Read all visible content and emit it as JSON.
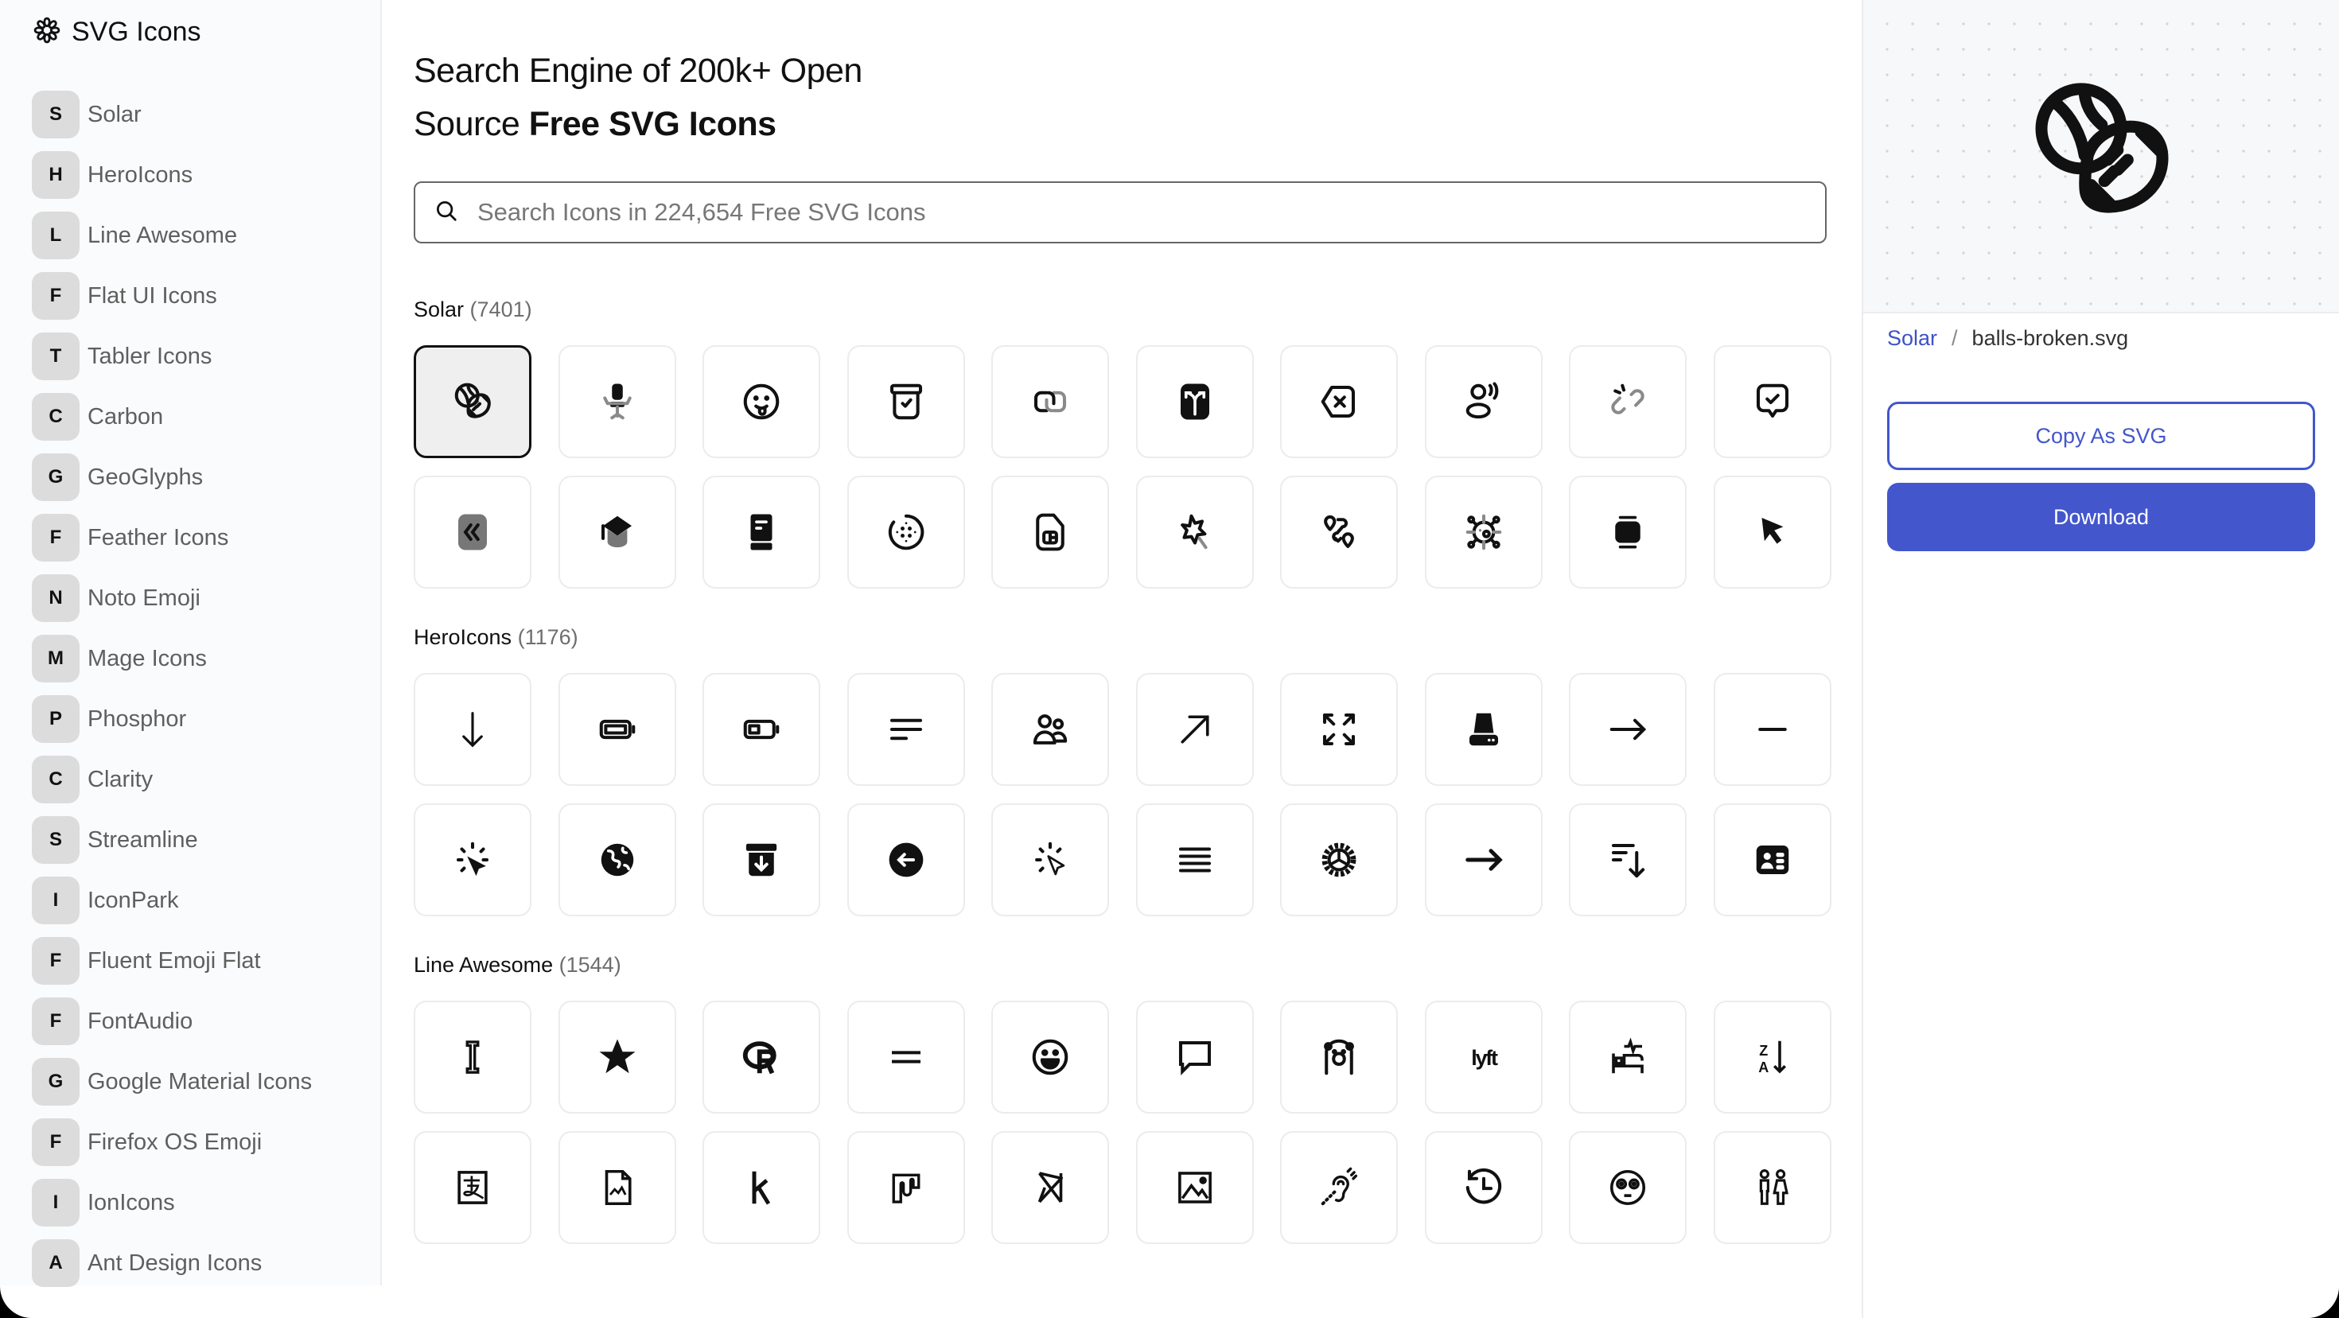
{
  "app": {
    "title": "SVG Icons",
    "logo_icon": "flower-outline-icon"
  },
  "sidebar": {
    "items": [
      {
        "letter": "S",
        "label": "Solar"
      },
      {
        "letter": "H",
        "label": "HeroIcons"
      },
      {
        "letter": "L",
        "label": "Line Awesome"
      },
      {
        "letter": "F",
        "label": "Flat UI Icons"
      },
      {
        "letter": "T",
        "label": "Tabler Icons"
      },
      {
        "letter": "C",
        "label": "Carbon"
      },
      {
        "letter": "G",
        "label": "GeoGlyphs"
      },
      {
        "letter": "F",
        "label": "Feather Icons"
      },
      {
        "letter": "N",
        "label": "Noto Emoji"
      },
      {
        "letter": "M",
        "label": "Mage Icons"
      },
      {
        "letter": "P",
        "label": "Phosphor"
      },
      {
        "letter": "C",
        "label": "Clarity"
      },
      {
        "letter": "S",
        "label": "Streamline"
      },
      {
        "letter": "I",
        "label": "IconPark"
      },
      {
        "letter": "F",
        "label": "Fluent Emoji Flat"
      },
      {
        "letter": "F",
        "label": "FontAudio"
      },
      {
        "letter": "G",
        "label": "Google Material Icons"
      },
      {
        "letter": "F",
        "label": "Firefox OS Emoji"
      },
      {
        "letter": "I",
        "label": "IonIcons"
      },
      {
        "letter": "A",
        "label": "Ant Design Icons"
      }
    ]
  },
  "hero": {
    "line1": "Search Engine of 200k+ Open",
    "line2_prefix": "Source ",
    "line2_bold": "Free SVG Icons"
  },
  "search": {
    "placeholder": "Search Icons in 224,654 Free SVG Icons",
    "value": "",
    "icon": "search-icon"
  },
  "sections": [
    {
      "name": "Solar",
      "count": "(7401)",
      "icons": [
        "balls-broken",
        "office-chair",
        "emoji-tongue",
        "archive-check",
        "link-square",
        "routing-split",
        "backspace-x",
        "user-speak",
        "link-broken",
        "chat-check",
        "double-alt-arrow-left",
        "graduation-cap",
        "book-bookmark",
        "speaker-dots",
        "sim-card",
        "magic-star-stick",
        "route-pins",
        "virus",
        "gallery-wide",
        "cursor"
      ]
    },
    {
      "name": "HeroIcons",
      "count": "(1176)",
      "icons": [
        "arrow-down",
        "battery-full",
        "battery-half",
        "bars-3-bottom-left",
        "users",
        "arrow-up-right",
        "arrows-pointing-out",
        "server-stack",
        "arrow-right",
        "minus",
        "cursor-rays-solid",
        "globe-europe-africa",
        "archive-box-arrow-down",
        "arrow-left-circle",
        "cursor-rays",
        "bars-4",
        "cog-8-tooth",
        "arrow-right-bold",
        "bars-arrow-down",
        "identification"
      ]
    },
    {
      "name": "Line Awesome",
      "count": "(1544)",
      "icons": [
        "i-cursor",
        "star",
        "r-project",
        "equals",
        "grin",
        "comment-alt",
        "otter",
        "lyft",
        "procedures",
        "sort-alpha-up-alt",
        "alipay",
        "file-image",
        "kickstarter-k",
        "mixcloud",
        "pied-piper-hat",
        "image",
        "deaf",
        "history",
        "flushed",
        "restroom"
      ]
    }
  ],
  "selected": {
    "set": "Solar",
    "file": "balls-broken.svg",
    "section_index": 0,
    "icon_index": 0
  },
  "panel": {
    "crumb_set": "Solar",
    "crumb_sep": "/",
    "crumb_file": "balls-broken.svg",
    "copy_label": "Copy As SVG",
    "download_label": "Download"
  },
  "colors": {
    "accent": "#4356cc",
    "sidebar_bg": "#fafbfd",
    "badge_bg": "#dcdcdc",
    "card_border": "#ececec",
    "selected_bg": "#efefef"
  }
}
